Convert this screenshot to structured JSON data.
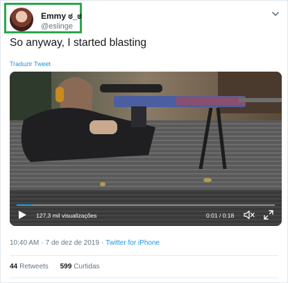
{
  "author": {
    "display_name": "Emmy ಠ_ಠ",
    "handle": "@eslinge"
  },
  "tweet": {
    "text": "So anyway, I started blasting",
    "translate_label": "Traduzir Tweet"
  },
  "video": {
    "views": "127,3 mil visualizações",
    "time": "0:01 / 0:18",
    "progress": 0.06
  },
  "meta": {
    "time": "10:40 AM",
    "separator": "·",
    "date": "7 de dez de 2019",
    "separator2": "·",
    "source": "Twitter for iPhone"
  },
  "stats": {
    "retweets_count": "44",
    "retweets_label": "Retweets",
    "likes_count": "599",
    "likes_label": "Curtidas"
  },
  "icons": [
    "caret-down-icon",
    "play-icon",
    "mute-icon",
    "fullscreen-icon"
  ]
}
